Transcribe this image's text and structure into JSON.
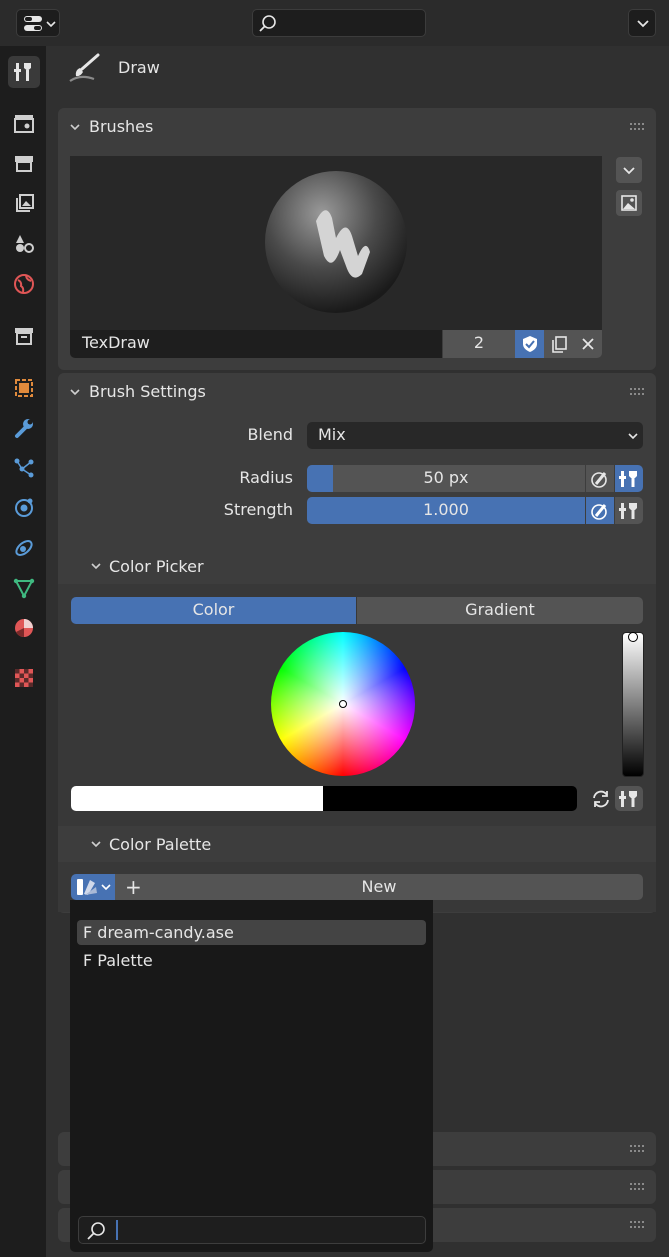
{
  "header": {
    "tool_name": "Draw",
    "search_placeholder": ""
  },
  "panels": {
    "brushes": {
      "title": "Brushes",
      "brush_name": "TexDraw",
      "users": "2"
    },
    "brush_settings": {
      "title": "Brush Settings",
      "blend_label": "Blend",
      "blend_value": "Mix",
      "radius_label": "Radius",
      "radius_value": "50 px",
      "radius_fraction": 0.05,
      "strength_label": "Strength",
      "strength_value": "1.000",
      "strength_fraction": 1.0
    },
    "color_picker": {
      "title": "Color Picker",
      "tab_color": "Color",
      "tab_gradient": "Gradient",
      "active_tab": "Color",
      "primary_color": "#ffffff",
      "secondary_color": "#000000"
    },
    "color_palette": {
      "title": "Color Palette",
      "new_label": "New",
      "new_icon": "+",
      "menu_items": [
        {
          "label": "F dream-candy.ase",
          "highlighted": true
        },
        {
          "label": "F Palette",
          "highlighted": false
        }
      ]
    }
  },
  "colors": {
    "accent": "#4772b3",
    "panel_bg": "#3d3d3d",
    "editor_bg": "#303030",
    "header_bg": "#2b2b2b"
  },
  "icons": {
    "tabs": [
      "tool-icon",
      "render-icon",
      "output-icon",
      "view-layer-icon",
      "scene-icon",
      "world-icon",
      "collection-icon",
      "object-icon",
      "modifier-icon",
      "particles-icon",
      "physics-icon",
      "constraints-icon",
      "data-icon",
      "material-icon",
      "texture-icon"
    ]
  }
}
